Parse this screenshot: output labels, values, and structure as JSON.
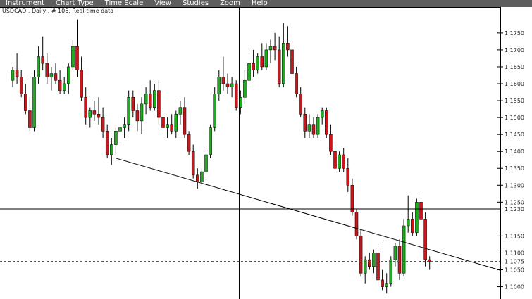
{
  "menu": {
    "items": [
      "Instrument",
      "Chart Type",
      "Time Scale",
      "View",
      "Studies",
      "Zoom",
      "Help"
    ]
  },
  "chart_header": "USDCAD , Daily , # 106, Real-time data",
  "price_labels": {
    "crosshair": "1.1230",
    "last": "1.1075"
  },
  "colors": {
    "menu_bg": "#5e5e5e",
    "up": "#1faa1f",
    "down": "#c8171b",
    "crosshair_label": "#0000ff",
    "last_label": "#e02020"
  },
  "chart_data": {
    "type": "candlestick",
    "instrument": "USDCAD",
    "timeframe": "Daily",
    "ylim": [
      1.097,
      1.181
    ],
    "yticks": [
      "1.1750",
      "1.1700",
      "1.1650",
      "1.1600",
      "1.1550",
      "1.1500",
      "1.1450",
      "1.1400",
      "1.1350",
      "1.1300",
      "1.1250",
      "1.1150",
      "1.1100",
      "1.1050",
      "1.1000"
    ],
    "crosshair_price": 1.123,
    "last_price": 1.1075,
    "trendline": [
      [
        24,
        1.138
      ],
      [
        115,
        1.1055
      ]
    ],
    "ohlc": [
      [
        1.161,
        1.165,
        1.159,
        1.164
      ],
      [
        1.164,
        1.169,
        1.16,
        1.162
      ],
      [
        1.162,
        1.164,
        1.156,
        1.157
      ],
      [
        1.157,
        1.16,
        1.151,
        1.152
      ],
      [
        1.152,
        1.156,
        1.146,
        1.147
      ],
      [
        1.147,
        1.164,
        1.146,
        1.162
      ],
      [
        1.162,
        1.171,
        1.16,
        1.168
      ],
      [
        1.168,
        1.174,
        1.164,
        1.166
      ],
      [
        1.166,
        1.169,
        1.16,
        1.162
      ],
      [
        1.162,
        1.165,
        1.158,
        1.163
      ],
      [
        1.163,
        1.166,
        1.16,
        1.161
      ],
      [
        1.161,
        1.164,
        1.157,
        1.158
      ],
      [
        1.158,
        1.162,
        1.157,
        1.16
      ],
      [
        1.16,
        1.166,
        1.157,
        1.165
      ],
      [
        1.165,
        1.173,
        1.164,
        1.171
      ],
      [
        1.171,
        1.179,
        1.162,
        1.164
      ],
      [
        1.164,
        1.168,
        1.155,
        1.156
      ],
      [
        1.156,
        1.159,
        1.148,
        1.15
      ],
      [
        1.15,
        1.153,
        1.147,
        1.152
      ],
      [
        1.152,
        1.155,
        1.149,
        1.151
      ],
      [
        1.151,
        1.156,
        1.148,
        1.15
      ],
      [
        1.15,
        1.153,
        1.144,
        1.146
      ],
      [
        1.146,
        1.148,
        1.138,
        1.139
      ],
      [
        1.139,
        1.144,
        1.136,
        1.142
      ],
      [
        1.142,
        1.147,
        1.139,
        1.146
      ],
      [
        1.146,
        1.151,
        1.143,
        1.147
      ],
      [
        1.147,
        1.15,
        1.144,
        1.148
      ],
      [
        1.148,
        1.158,
        1.146,
        1.156
      ],
      [
        1.156,
        1.158,
        1.15,
        1.152
      ],
      [
        1.152,
        1.154,
        1.146,
        1.149
      ],
      [
        1.149,
        1.156,
        1.145,
        1.154
      ],
      [
        1.154,
        1.159,
        1.151,
        1.157
      ],
      [
        1.157,
        1.161,
        1.152,
        1.153
      ],
      [
        1.153,
        1.16,
        1.152,
        1.158
      ],
      [
        1.158,
        1.161,
        1.148,
        1.15
      ],
      [
        1.15,
        1.152,
        1.146,
        1.147
      ],
      [
        1.147,
        1.15,
        1.144,
        1.148
      ],
      [
        1.148,
        1.151,
        1.145,
        1.146
      ],
      [
        1.146,
        1.152,
        1.144,
        1.151
      ],
      [
        1.151,
        1.155,
        1.148,
        1.153
      ],
      [
        1.153,
        1.156,
        1.144,
        1.145
      ],
      [
        1.145,
        1.146,
        1.139,
        1.14
      ],
      [
        1.14,
        1.142,
        1.132,
        1.133
      ],
      [
        1.133,
        1.135,
        1.129,
        1.131
      ],
      [
        1.131,
        1.135,
        1.13,
        1.134
      ],
      [
        1.134,
        1.14,
        1.132,
        1.139
      ],
      [
        1.139,
        1.148,
        1.138,
        1.147
      ],
      [
        1.147,
        1.159,
        1.146,
        1.157
      ],
      [
        1.157,
        1.164,
        1.155,
        1.162
      ],
      [
        1.162,
        1.168,
        1.158,
        1.16
      ],
      [
        1.16,
        1.163,
        1.157,
        1.159
      ],
      [
        1.159,
        1.162,
        1.156,
        1.16
      ],
      [
        1.16,
        1.161,
        1.152,
        1.153
      ],
      [
        1.153,
        1.158,
        1.151,
        1.156
      ],
      [
        1.156,
        1.164,
        1.154,
        1.161
      ],
      [
        1.161,
        1.169,
        1.159,
        1.166
      ],
      [
        1.166,
        1.17,
        1.162,
        1.164
      ],
      [
        1.164,
        1.169,
        1.163,
        1.168
      ],
      [
        1.168,
        1.172,
        1.164,
        1.165
      ],
      [
        1.165,
        1.172,
        1.164,
        1.17
      ],
      [
        1.17,
        1.173,
        1.166,
        1.171
      ],
      [
        1.171,
        1.175,
        1.167,
        1.17
      ],
      [
        1.17,
        1.174,
        1.159,
        1.16
      ],
      [
        1.16,
        1.178,
        1.159,
        1.172
      ],
      [
        1.172,
        1.177,
        1.168,
        1.17
      ],
      [
        1.17,
        1.171,
        1.162,
        1.163
      ],
      [
        1.163,
        1.165,
        1.156,
        1.157
      ],
      [
        1.157,
        1.159,
        1.15,
        1.151
      ],
      [
        1.151,
        1.153,
        1.144,
        1.146
      ],
      [
        1.146,
        1.151,
        1.144,
        1.148
      ],
      [
        1.148,
        1.15,
        1.144,
        1.145
      ],
      [
        1.145,
        1.151,
        1.144,
        1.15
      ],
      [
        1.15,
        1.153,
        1.148,
        1.152
      ],
      [
        1.152,
        1.153,
        1.144,
        1.145
      ],
      [
        1.145,
        1.148,
        1.139,
        1.14
      ],
      [
        1.14,
        1.142,
        1.134,
        1.135
      ],
      [
        1.135,
        1.14,
        1.134,
        1.139
      ],
      [
        1.139,
        1.141,
        1.134,
        1.135
      ],
      [
        1.135,
        1.138,
        1.128,
        1.13
      ],
      [
        1.13,
        1.132,
        1.121,
        1.122
      ],
      [
        1.122,
        1.123,
        1.114,
        1.115
      ],
      [
        1.115,
        1.117,
        1.103,
        1.104
      ],
      [
        1.104,
        1.109,
        1.101,
        1.108
      ],
      [
        1.108,
        1.11,
        1.105,
        1.106
      ],
      [
        1.106,
        1.111,
        1.104,
        1.11
      ],
      [
        1.11,
        1.112,
        1.101,
        1.102
      ],
      [
        1.102,
        1.105,
        1.099,
        1.1
      ],
      [
        1.1,
        1.104,
        1.098,
        1.101
      ],
      [
        1.101,
        1.109,
        1.1,
        1.108
      ],
      [
        1.108,
        1.113,
        1.106,
        1.112
      ],
      [
        1.112,
        1.114,
        1.102,
        1.104
      ],
      [
        1.104,
        1.12,
        1.103,
        1.118
      ],
      [
        1.118,
        1.127,
        1.116,
        1.12
      ],
      [
        1.12,
        1.122,
        1.115,
        1.116
      ],
      [
        1.116,
        1.126,
        1.115,
        1.125
      ],
      [
        1.125,
        1.127,
        1.119,
        1.12
      ],
      [
        1.12,
        1.122,
        1.106,
        1.108
      ],
      [
        1.108,
        1.109,
        1.105,
        1.1075
      ]
    ]
  }
}
